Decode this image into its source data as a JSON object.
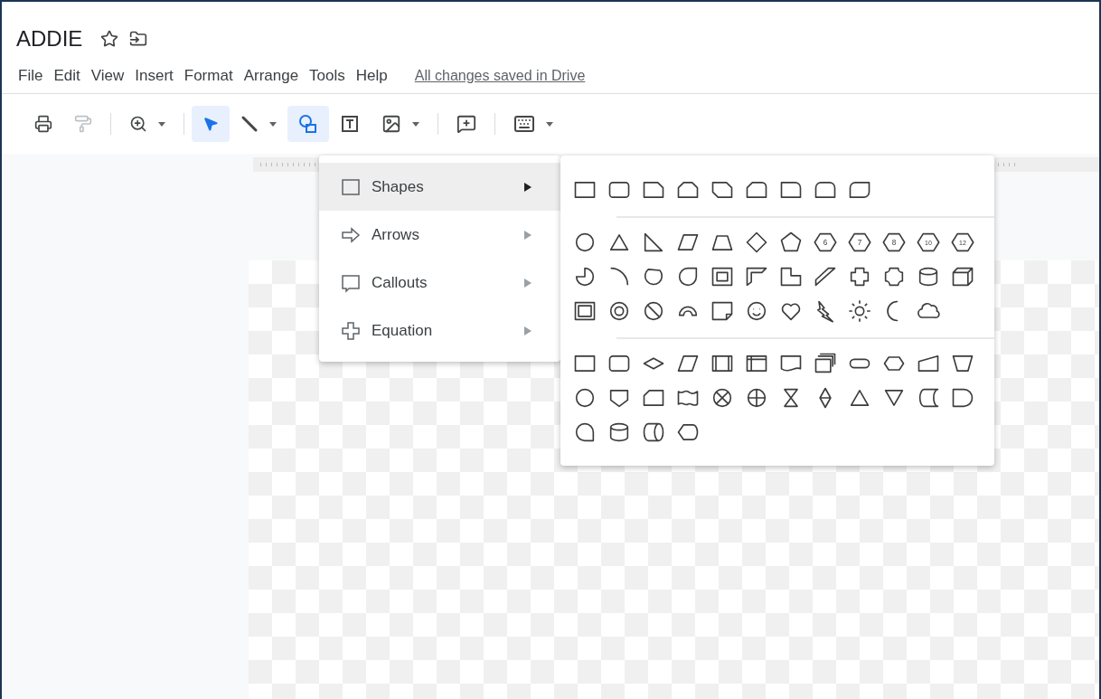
{
  "document": {
    "title": "ADDIE"
  },
  "menu_bar": {
    "items": [
      "File",
      "Edit",
      "View",
      "Insert",
      "Format",
      "Arrange",
      "Tools",
      "Help"
    ],
    "save_status": "All changes saved in Drive"
  },
  "toolbar": {
    "tools": [
      {
        "kind": "print",
        "selected": false,
        "disabled": false
      },
      {
        "kind": "paint-format",
        "selected": false,
        "disabled": true
      },
      {
        "kind": "divider"
      },
      {
        "kind": "zoom",
        "selected": false,
        "disabled": false
      },
      {
        "kind": "divider"
      },
      {
        "kind": "select",
        "selected": true,
        "disabled": false
      },
      {
        "kind": "line",
        "selected": false,
        "disabled": false
      },
      {
        "kind": "shape",
        "selected": true,
        "disabled": false
      },
      {
        "kind": "text-box",
        "selected": false,
        "disabled": false
      },
      {
        "kind": "image",
        "selected": false,
        "disabled": false
      },
      {
        "kind": "divider"
      },
      {
        "kind": "comment",
        "selected": false,
        "disabled": false
      },
      {
        "kind": "divider"
      },
      {
        "kind": "input-tools",
        "selected": false,
        "disabled": false
      }
    ]
  },
  "shape_menu": {
    "items": [
      {
        "kind": "shapes",
        "label": "Shapes",
        "selected": true
      },
      {
        "kind": "arrows",
        "label": "Arrows",
        "selected": false
      },
      {
        "kind": "callouts",
        "label": "Callouts",
        "selected": false
      },
      {
        "kind": "equation",
        "label": "Equation",
        "selected": false
      }
    ]
  },
  "shapes_submenu": {
    "groups": [
      {
        "rows": [
          [
            {
              "kind": "rect"
            },
            {
              "kind": "round-rect"
            },
            {
              "kind": "snip1"
            },
            {
              "kind": "snip2-same"
            },
            {
              "kind": "snip2-diag"
            },
            {
              "kind": "snip-round"
            },
            {
              "kind": "round1"
            },
            {
              "kind": "round2-same"
            },
            {
              "kind": "round2-diag"
            }
          ]
        ]
      },
      {
        "rows": [
          [
            {
              "kind": "ellipse"
            },
            {
              "kind": "triangle"
            },
            {
              "kind": "right-triangle"
            },
            {
              "kind": "parallelogram"
            },
            {
              "kind": "trapezoid"
            },
            {
              "kind": "diamond"
            },
            {
              "kind": "pentagon"
            },
            {
              "kind": "polygon",
              "label": "6"
            },
            {
              "kind": "polygon",
              "label": "7"
            },
            {
              "kind": "polygon",
              "label": "8"
            },
            {
              "kind": "polygon",
              "label": "10"
            },
            {
              "kind": "polygon",
              "label": "12"
            }
          ],
          [
            {
              "kind": "pie"
            },
            {
              "kind": "arc"
            },
            {
              "kind": "chord"
            },
            {
              "kind": "teardrop"
            },
            {
              "kind": "frame"
            },
            {
              "kind": "half-frame"
            },
            {
              "kind": "l-shape"
            },
            {
              "kind": "diagonal-stripe"
            },
            {
              "kind": "cross"
            },
            {
              "kind": "plaque"
            },
            {
              "kind": "can"
            },
            {
              "kind": "cube"
            }
          ],
          [
            {
              "kind": "bevel"
            },
            {
              "kind": "donut"
            },
            {
              "kind": "no-symbol"
            },
            {
              "kind": "block-arc"
            },
            {
              "kind": "folded-corner"
            },
            {
              "kind": "smiley"
            },
            {
              "kind": "heart"
            },
            {
              "kind": "lightning"
            },
            {
              "kind": "sun"
            },
            {
              "kind": "moon"
            },
            {
              "kind": "cloud"
            }
          ]
        ]
      },
      {
        "rows": [
          [
            {
              "kind": "rect"
            },
            {
              "kind": "round-rect"
            },
            {
              "kind": "decision"
            },
            {
              "kind": "parallelogram"
            },
            {
              "kind": "predefined-process"
            },
            {
              "kind": "internal-storage"
            },
            {
              "kind": "document"
            },
            {
              "kind": "multidocument"
            },
            {
              "kind": "terminator"
            },
            {
              "kind": "preparation"
            },
            {
              "kind": "manual-input"
            },
            {
              "kind": "manual-operation"
            }
          ],
          [
            {
              "kind": "ellipse"
            },
            {
              "kind": "offpage"
            },
            {
              "kind": "card"
            },
            {
              "kind": "punched-tape"
            },
            {
              "kind": "summing-junction"
            },
            {
              "kind": "or"
            },
            {
              "kind": "collate"
            },
            {
              "kind": "sort"
            },
            {
              "kind": "triangle"
            },
            {
              "kind": "merge"
            },
            {
              "kind": "stored-data"
            },
            {
              "kind": "delay"
            }
          ],
          [
            {
              "kind": "sequential-access"
            },
            {
              "kind": "can"
            },
            {
              "kind": "direct-access"
            },
            {
              "kind": "display"
            }
          ]
        ]
      }
    ]
  }
}
